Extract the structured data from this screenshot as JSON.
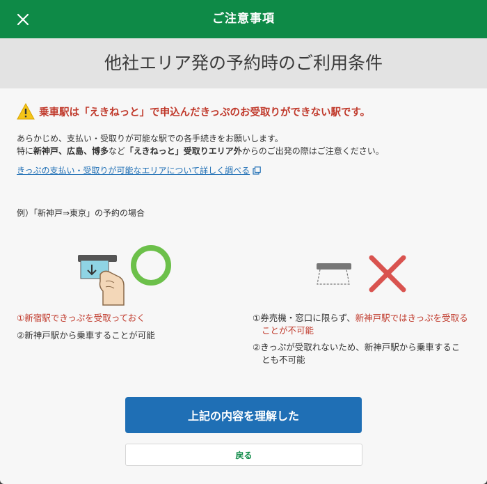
{
  "header": {
    "title": "ご注意事項",
    "close_icon": "close-icon"
  },
  "page_title": "他社エリア発の予約時のご利用条件",
  "warning": {
    "icon": "warning-icon",
    "text": "乗車駅は「えきねっと」で申込んだきっぷのお受取りができない駅です。"
  },
  "description": {
    "line1": "あらかじめ、支払い・受取りが可能な駅での各手続きをお願いします。",
    "line2_prefix": "特に",
    "line2_bold": "新神戸、広島、博多",
    "line2_mid": "など",
    "line2_bold2": "「えきねっと」受取りエリア外",
    "line2_suffix": "からのご出発の際はご注意ください。"
  },
  "link": {
    "text": "きっぷの支払い・受取りが可能なエリアについて詳しく調べる",
    "icon": "external-link-icon"
  },
  "example_label": "例）「新神戸⇒東京」の予約の場合",
  "left_case": {
    "note1": "①新宿駅できっぷを受取っておく",
    "note2": "②新神戸駅から乗車することが可能",
    "mark": "check-circle-icon",
    "illustration": "ticket-machine-hand-icon"
  },
  "right_case": {
    "note1_prefix": "①券売機・窓口に限らず、",
    "note1_red_line1": "新神戸駅ではきっぷを受取る",
    "note1_red_line2": "ことが不可能",
    "note2_line1": "②きっぷが受取れないため、新神戸駅から乗車するこ",
    "note2_line2": "とも不可能",
    "mark": "cross-icon",
    "illustration": "ticket-slot-empty-icon"
  },
  "buttons": {
    "primary": "上記の内容を理解した",
    "secondary": "戻る"
  },
  "colors": {
    "brand_green": "#0e8a47",
    "primary_blue": "#1f6fb5",
    "warning_red": "#c0392b",
    "ok_green": "#6cc04a",
    "ng_red": "#d9534f"
  }
}
